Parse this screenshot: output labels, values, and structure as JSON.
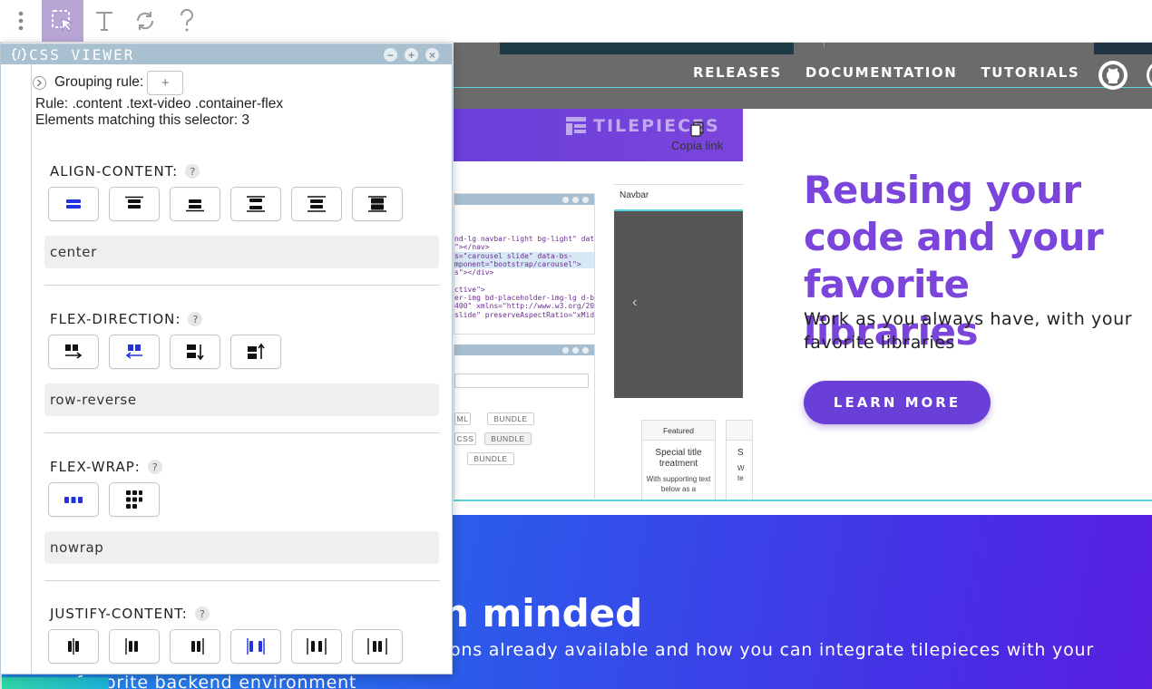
{
  "toolbar": {
    "items": [
      {
        "name": "more-options",
        "icon": "vertical-dots-icon"
      },
      {
        "name": "select-element",
        "icon": "select-pointer-icon",
        "active": true
      },
      {
        "name": "text-tool",
        "icon": "text-T-icon"
      },
      {
        "name": "refresh",
        "icon": "refresh-icon"
      },
      {
        "name": "help",
        "icon": "question-mark-icon"
      }
    ],
    "active_color": "#b7a5d6"
  },
  "site": {
    "nav": [
      "RELEASES",
      "DOCUMENTATION",
      "TUTORIALS"
    ],
    "logo_text": "TILEPIECES",
    "copy_link": "Copia link",
    "mock": {
      "code_lines": [
        "nd-lg navbar-light bg-light\" data-tilepieces-",
        "\"></nav>",
        "s=\"carousel slide\" data-bs-",
        "mponent=\"bootstrap/carousel\">",
        "s\"></div>",
        "",
        "ctive\">",
        "er-img bd-placeholder-img-lg d-block w-",
        "400\" xmlns=\"http://www.w3.org/2000/svg\"",
        "slide\" preserveAspectRatio=\"xMidYMid"
      ],
      "tags": [
        "ML",
        "BUNDLE",
        "CSS",
        "BUNDLE",
        "BUNDLE"
      ],
      "navbar_label": "Navbar",
      "card_caption": "Featured",
      "card_title": "Special title treatment",
      "card_text": "With supporting text below as a",
      "card2_title": "S",
      "card2_text": "W te"
    },
    "hero": {
      "title": "Reusing your\ncode and your\nfavorite libraries",
      "subtitle": "Work as you always have, with your favorite libraries",
      "button": "LEARN MORE",
      "accent": "#7b45dc"
    },
    "section2": {
      "title": "n minded",
      "subtitle": "ons already available and how you can integrate tilepieces with your",
      "subtitle2": "favorite backend environment"
    }
  },
  "viewer": {
    "title": "CSS VIEWER",
    "header_color": "#a9c0d1",
    "window_buttons": [
      "−",
      "+",
      "×"
    ],
    "grouping_label": "Grouping rule:",
    "grouping_add": "+",
    "rule_line": "Rule:  .content .text-video .container-flex",
    "match_line": "Elements matching this selector: 3",
    "help_glyph": "?",
    "properties": [
      {
        "label": "ALIGN-CONTENT:",
        "value": "center",
        "selected_index": 0,
        "options": [
          "align-center-icon",
          "align-start-icon",
          "align-end-icon",
          "align-space-between-icon",
          "align-space-around-icon",
          "align-stretch-icon"
        ]
      },
      {
        "label": "FLEX-DIRECTION:",
        "value": "row-reverse",
        "selected_index": 1,
        "options": [
          "direction-row-icon",
          "direction-row-reverse-icon",
          "direction-column-icon",
          "direction-column-reverse-icon"
        ]
      },
      {
        "label": "FLEX-WRAP:",
        "value": "nowrap",
        "selected_index": 0,
        "options": [
          "wrap-nowrap-icon",
          "wrap-wrap-icon"
        ]
      },
      {
        "label": "JUSTIFY-CONTENT:",
        "value": "",
        "selected_index": 3,
        "options": [
          "justify-center-icon",
          "justify-start-icon",
          "justify-end-icon",
          "justify-space-between-icon",
          "justify-space-around-icon",
          "justify-space-evenly-icon"
        ]
      }
    ],
    "selected_icon_color": "#2233dd"
  }
}
